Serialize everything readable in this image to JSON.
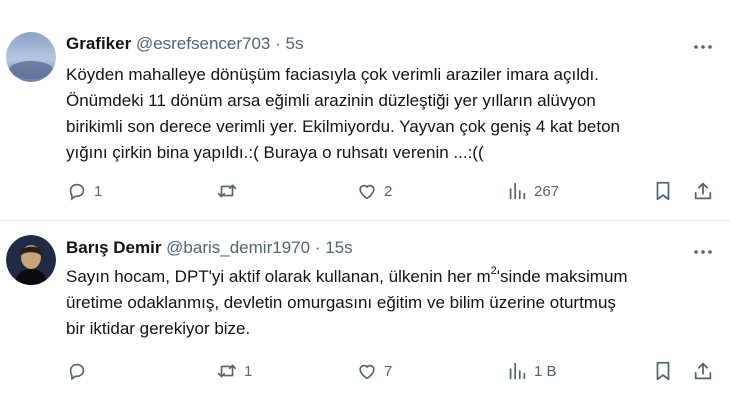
{
  "tweets": [
    {
      "author_name": "Grafiker",
      "handle": "@esrefsencer703",
      "separator": "·",
      "time": "5s",
      "more_label": "...",
      "lines": [
        "Köyden mahalleye dönüşüm faciasıyla çok verimli araziler imara açıldı.",
        "Önümdeki 11 dönüm arsa eğimli arazinin düzleştiği yer yılların alüvyon",
        "birikimli son derece verimli yer. Ekilmiyordu. Yayvan çok geniş 4 kat beton",
        "yığını çirkin bina yapıldı.:( Buraya o ruhsatı verenin ...:(("
      ],
      "replies": "1",
      "retweets": "",
      "likes": "2",
      "views": "267"
    },
    {
      "author_name": "Barış Demir",
      "handle": "@baris_demir1970",
      "separator": "·",
      "time": "15s",
      "more_label": "...",
      "line1_a": "Sayın hocam, DPT'yi aktif olarak kullanan, ülkenin her m",
      "line1_sup": "2",
      "line1_b": "'sinde maksimum",
      "lines": [
        "üretime odaklanmış, devletin omurgasını eğitim ve bilim üzerine oturtmuş",
        "bir iktidar gerekiyor bize."
      ],
      "replies": "",
      "retweets": "1",
      "likes": "7",
      "views": "1 B"
    }
  ],
  "colors": {
    "text": "#0f1419",
    "secondary": "#536471",
    "divider": "#e6ecf0"
  },
  "icons": [
    "reply-icon",
    "retweet-icon",
    "like-icon",
    "views-icon",
    "bookmark-icon",
    "share-icon",
    "more-icon"
  ]
}
